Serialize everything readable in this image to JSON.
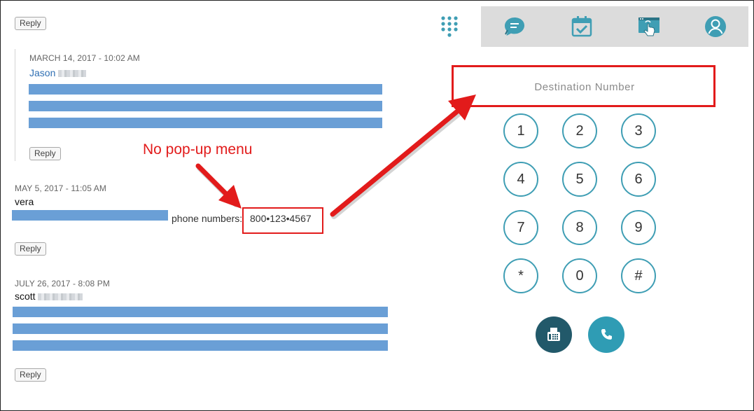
{
  "colors": {
    "annotation_red": "#e21b1b",
    "link_blue": "#2f6fb3",
    "redacted_bar": "#6a9fd6",
    "teal_accent": "#3f9eb4",
    "fax_button": "#22596a",
    "call_button": "#2f9cb4",
    "nav_background": "#dcdcdc"
  },
  "comments": [
    {
      "reply_label": "Reply"
    },
    {
      "timestamp": "MARCH 14, 2017 - 10:02 AM",
      "author": "Jason",
      "reply_label": "Reply"
    },
    {
      "timestamp": "MAY 5, 2017 - 11:05 AM",
      "author": "vera",
      "phone_label": "phone numbers:",
      "phone_number": "800•123•4567",
      "reply_label": "Reply"
    },
    {
      "timestamp": "JULY 26, 2017 - 8:08 PM",
      "author": "scott",
      "reply_label": "Reply"
    }
  ],
  "annotation": {
    "text": "No pop-up menu"
  },
  "dialer": {
    "tabs": [
      {
        "icon": "dialpad-icon",
        "active": true
      },
      {
        "icon": "chat-bubble-icon",
        "active": false
      },
      {
        "icon": "calendar-check-icon",
        "active": false
      },
      {
        "icon": "screen-touch-icon",
        "active": false
      },
      {
        "icon": "user-profile-icon",
        "active": false
      }
    ],
    "destination_placeholder": "Destination Number",
    "keys": [
      "1",
      "2",
      "3",
      "4",
      "5",
      "6",
      "7",
      "8",
      "9",
      "*",
      "0",
      "#"
    ],
    "fax_icon": "fax-icon",
    "call_icon": "phone-icon"
  }
}
